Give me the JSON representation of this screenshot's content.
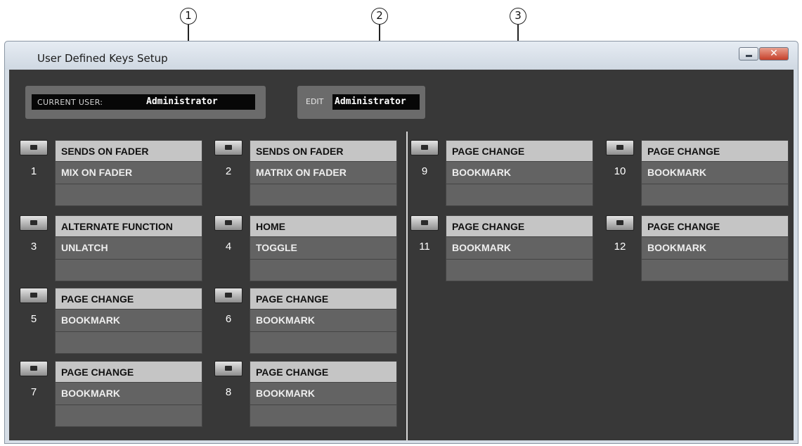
{
  "callouts": [
    "1",
    "2",
    "3"
  ],
  "window": {
    "title": "User Defined Keys Setup",
    "close_label": "✕"
  },
  "current_user": {
    "label": "CURRENT USER:",
    "value": "Administrator"
  },
  "edit": {
    "label": "EDIT",
    "value": "Administrator"
  },
  "keys": [
    {
      "number": "1",
      "function": "SENDS ON FADER",
      "param1": "MIX ON FADER",
      "param2": ""
    },
    {
      "number": "2",
      "function": "SENDS ON FADER",
      "param1": "MATRIX ON FADER",
      "param2": ""
    },
    {
      "number": "3",
      "function": "ALTERNATE FUNCTION",
      "param1": "UNLATCH",
      "param2": ""
    },
    {
      "number": "4",
      "function": "HOME",
      "param1": "TOGGLE",
      "param2": ""
    },
    {
      "number": "5",
      "function": "PAGE CHANGE",
      "param1": "BOOKMARK",
      "param2": ""
    },
    {
      "number": "6",
      "function": "PAGE CHANGE",
      "param1": "BOOKMARK",
      "param2": ""
    },
    {
      "number": "7",
      "function": "PAGE CHANGE",
      "param1": "BOOKMARK",
      "param2": ""
    },
    {
      "number": "8",
      "function": "PAGE CHANGE",
      "param1": "BOOKMARK",
      "param2": ""
    },
    {
      "number": "9",
      "function": "PAGE CHANGE",
      "param1": "BOOKMARK",
      "param2": ""
    },
    {
      "number": "10",
      "function": "PAGE CHANGE",
      "param1": "BOOKMARK",
      "param2": ""
    },
    {
      "number": "11",
      "function": "PAGE CHANGE",
      "param1": "BOOKMARK",
      "param2": ""
    },
    {
      "number": "12",
      "function": "PAGE CHANGE",
      "param1": "BOOKMARK",
      "param2": ""
    }
  ]
}
